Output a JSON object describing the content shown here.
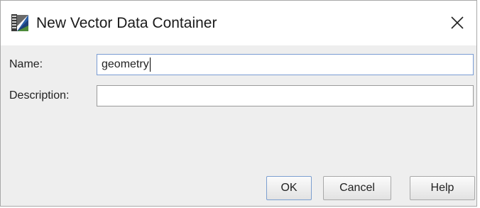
{
  "window": {
    "title": "New Vector Data Container",
    "app_icon": "vector-layer-icon",
    "close_icon": "close-icon"
  },
  "form": {
    "name_label": "Name:",
    "name_value": "geometry",
    "description_label": "Description:",
    "description_value": ""
  },
  "buttons": {
    "ok_label": "OK",
    "cancel_label": "Cancel",
    "help_label": "Help"
  },
  "colors": {
    "content_background": "#eeeeee",
    "focus_border": "#7a9cd3"
  }
}
